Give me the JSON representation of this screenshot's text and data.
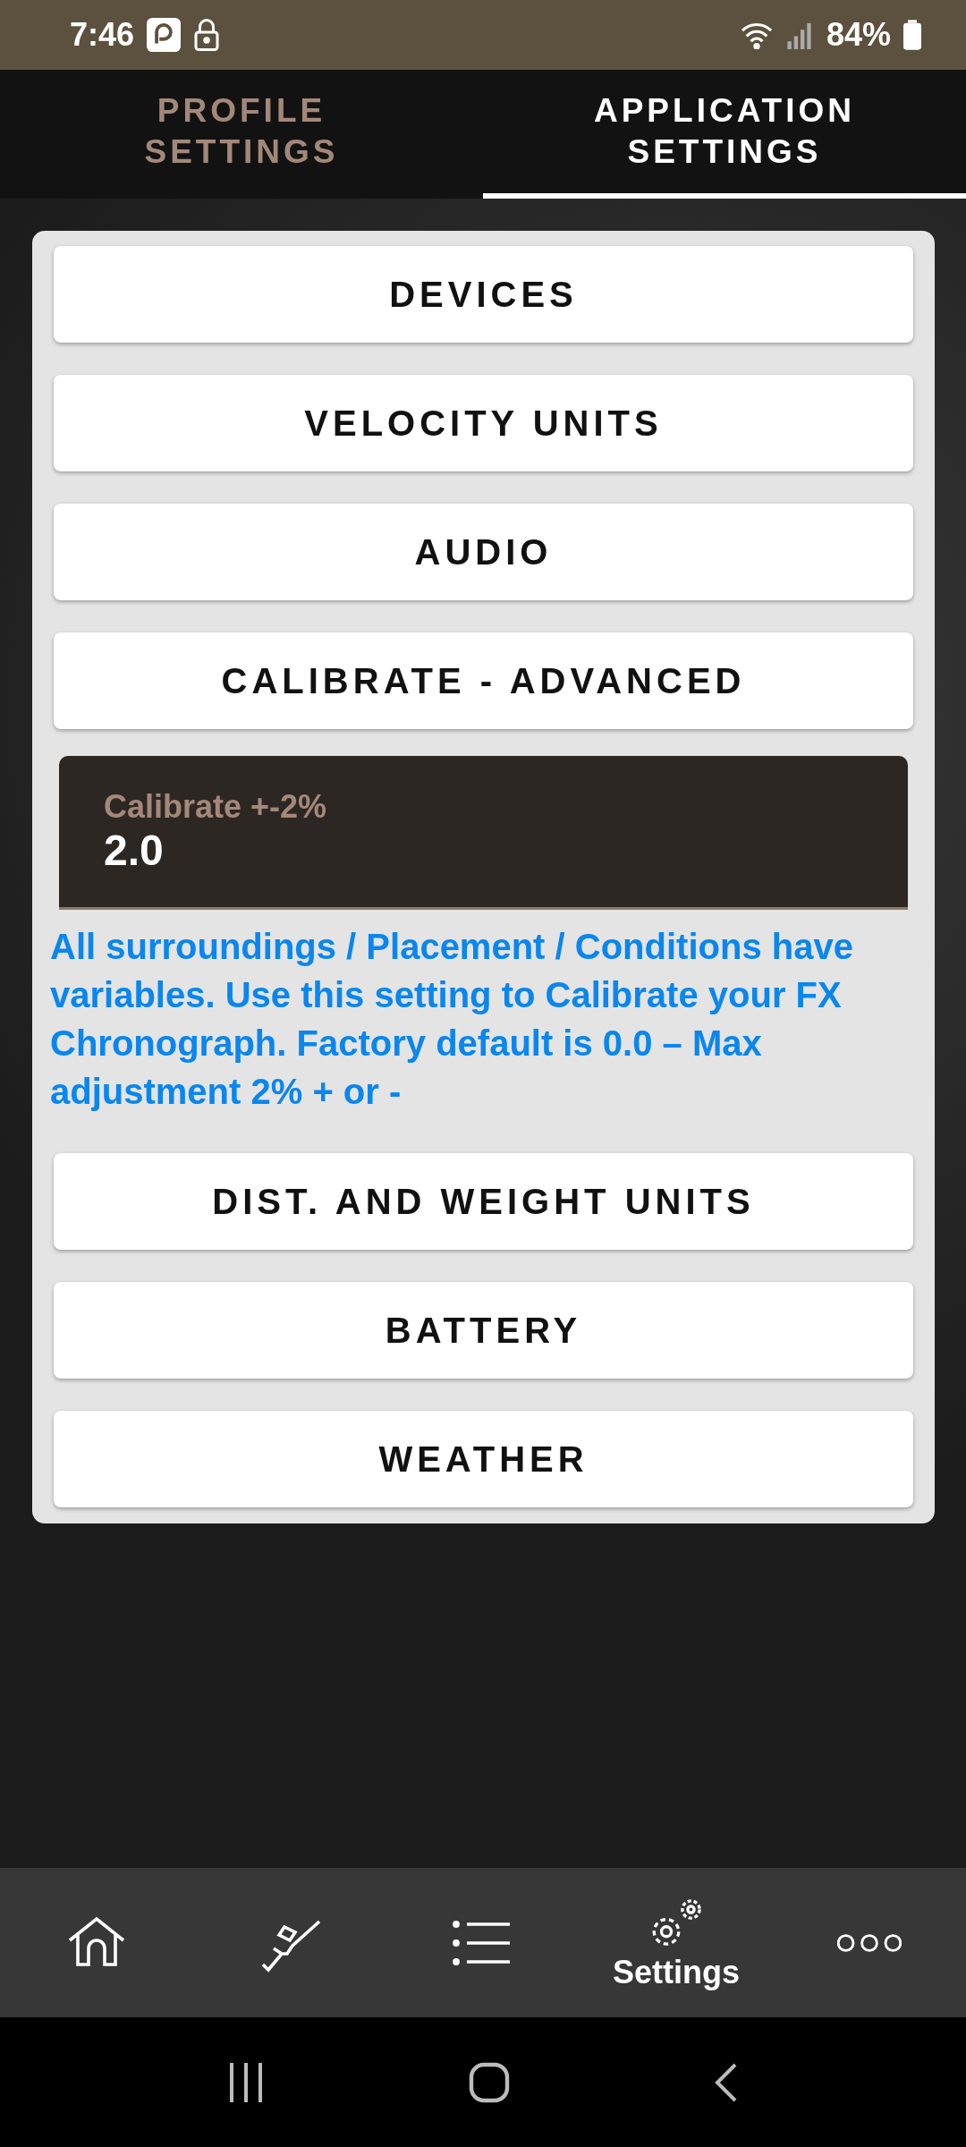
{
  "status_bar": {
    "time": "7:46",
    "battery": "84%"
  },
  "tabs": [
    {
      "label": "PROFILE\nSETTINGS",
      "selected": false
    },
    {
      "label": "APPLICATION\nSETTINGS",
      "selected": true
    }
  ],
  "settings": [
    {
      "kind": "button",
      "label": "DEVICES"
    },
    {
      "kind": "button",
      "label": "VELOCITY UNITS"
    },
    {
      "kind": "button",
      "label": "AUDIO"
    },
    {
      "kind": "button",
      "label": "CALIBRATE - ADVANCED"
    },
    {
      "kind": "field",
      "label": "Calibrate +-2%",
      "value": "2.0"
    },
    {
      "kind": "note",
      "text": "All surroundings / Placement / Conditions have variables. Use this setting to Calibrate your FX Chronograph. Factory default is 0.0 – Max adjustment 2% + or -"
    },
    {
      "kind": "button",
      "label": "DIST. AND WEIGHT UNITS"
    },
    {
      "kind": "button",
      "label": "BATTERY"
    },
    {
      "kind": "button",
      "label": "WEATHER"
    }
  ],
  "bottom_nav": [
    {
      "kind": "home"
    },
    {
      "kind": "rifle"
    },
    {
      "kind": "list"
    },
    {
      "kind": "settings",
      "label": "Settings"
    },
    {
      "kind": "more"
    }
  ]
}
